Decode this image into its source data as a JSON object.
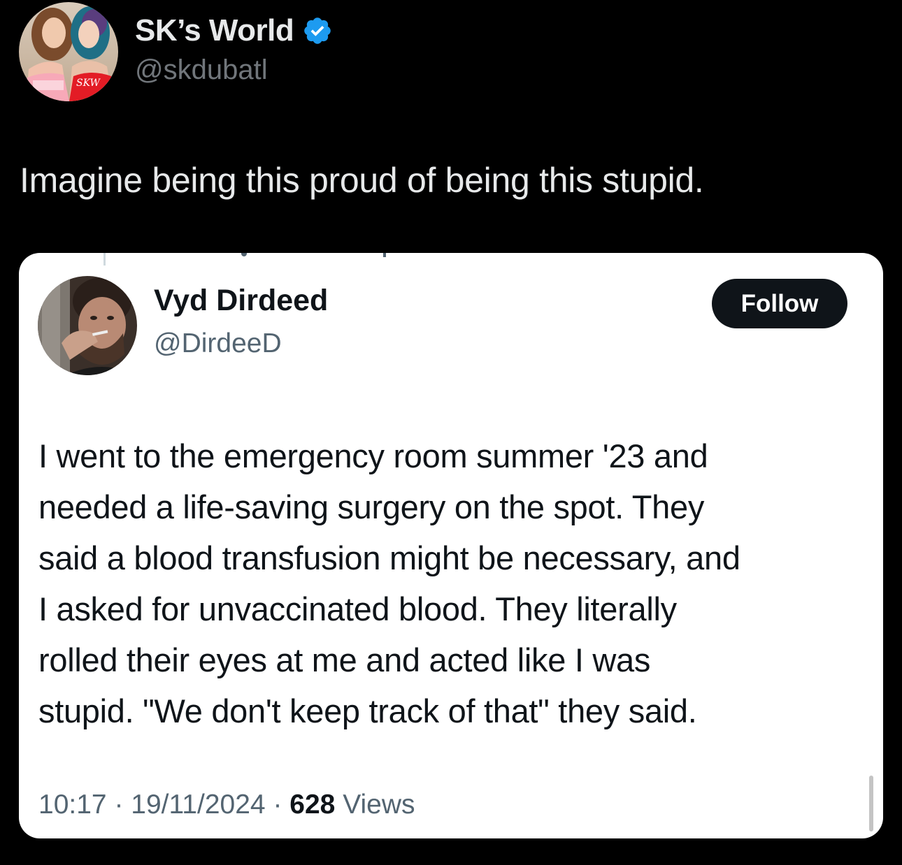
{
  "outer_tweet": {
    "author_name": "SK’s World",
    "author_handle": "@skdubatl",
    "avatar_shirt_text": "SKW",
    "text": "Imagine being this proud of being this stupid."
  },
  "quoted_screenshot": {
    "author_name": "Vyd Dirdeed",
    "author_handle": "@DirdeeD",
    "follow_label": "Follow",
    "text_lines": [
      "I went to the emergency room summer '23 and",
      "needed a life-saving surgery on the spot. They",
      "said a blood transfusion might be necessary, and",
      "I asked for unvaccinated blood. They literally",
      "rolled their eyes at me and acted like I was",
      "stupid. \"We don't keep track of that\" they said."
    ],
    "time": "10:17",
    "separator": "·",
    "date": "19/11/2024",
    "views_count": "628",
    "views_label": "Views"
  },
  "colors": {
    "background": "#000000",
    "verified_blue": "#1d9bf0",
    "primary_text_dark": "#e7e9ea",
    "secondary_text_dark": "#71767b",
    "primary_text_light": "#0f1419",
    "secondary_text_light": "#536471"
  },
  "icons": {
    "verified": "verified-badge-icon"
  }
}
